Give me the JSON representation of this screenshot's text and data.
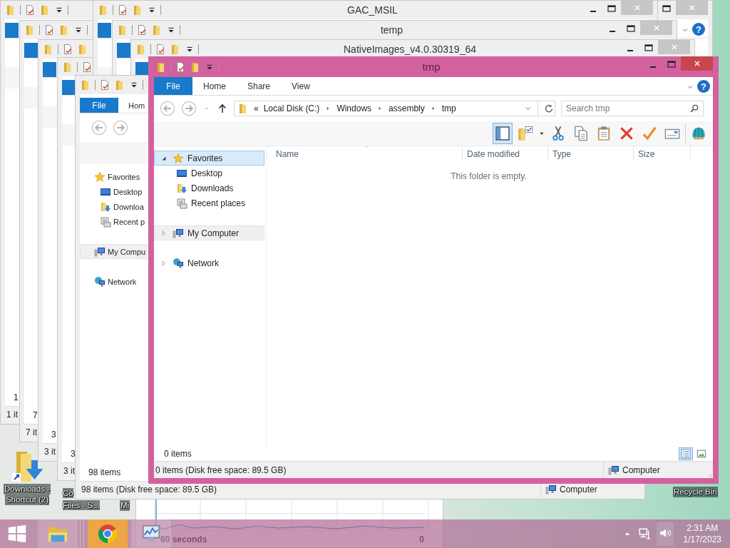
{
  "desktop_icons": [
    {
      "lines": [
        "Downloads -",
        "Shortcut (2)"
      ]
    },
    {
      "lines": [
        "Co",
        "Files - S..."
      ]
    },
    {
      "lines": [
        "Mi"
      ]
    }
  ],
  "recycle_bin": "Recycle Bin",
  "chart_window": {
    "x_label": "60 seconds",
    "y_value": "0"
  },
  "background_windows": [
    {
      "count": "1",
      "status": "1 it",
      "help": "?"
    },
    {
      "count": "7",
      "status": "7 it"
    },
    {
      "count": "3",
      "status": "3 it"
    },
    {
      "count": "3",
      "status": "3 it"
    },
    {
      "title": "GAC_MSIL"
    },
    {
      "title": "temp"
    },
    {
      "title": "NativeImages_v4.0.30319_64"
    },
    {
      "tabs": [
        {
          "label": "File",
          "kind": "file"
        },
        {
          "label": "Hom",
          "kind": "tab"
        }
      ],
      "nav": [
        {
          "label": "Favorites",
          "selected": false,
          "shaded": false,
          "children": [
            {
              "label": "Desktop"
            },
            {
              "label": "Downloa"
            },
            {
              "label": "Recent p"
            }
          ]
        },
        {
          "label": "My Compu",
          "selected": false,
          "shaded": true
        },
        {
          "label": "Network",
          "selected": false,
          "shaded": false
        }
      ],
      "count": "98 items",
      "status": "98 items (Disk free space: 89.5 GB)",
      "location": "Computer"
    }
  ],
  "window": {
    "title": "tmp",
    "tabs": [
      {
        "label": "File",
        "kind": "file"
      },
      {
        "label": "Home",
        "kind": "tab"
      },
      {
        "label": "Share",
        "kind": "tab"
      },
      {
        "label": "View",
        "kind": "tab"
      }
    ],
    "help": "?",
    "address": {
      "overflow": "«",
      "crumbs": [
        "Local Disk (C:)",
        "Windows",
        "assembly",
        "tmp"
      ]
    },
    "search": {
      "placeholder": "Search tmp"
    },
    "toolbar": [
      {
        "selected": true
      },
      {
        "selected": false
      },
      {
        "selected": false
      },
      {
        "selected": false
      },
      {
        "selected": false
      },
      {
        "selected": false
      },
      {
        "selected": false
      },
      {
        "selected": false
      },
      {
        "selected": false
      }
    ],
    "nav": [
      {
        "label": "Favorites",
        "expanded": true,
        "selected": true,
        "shaded": false,
        "children": [
          {
            "label": "Desktop"
          },
          {
            "label": "Downloads"
          },
          {
            "label": "Recent places"
          }
        ]
      },
      {
        "label": "My Computer",
        "expanded": false,
        "selected": false,
        "shaded": true
      },
      {
        "label": "Network",
        "expanded": false,
        "selected": false,
        "shaded": false
      }
    ],
    "columns": [
      {
        "label": "Name",
        "sorted": true
      },
      {
        "label": "Date modified",
        "sorted": false
      },
      {
        "label": "Type",
        "sorted": false
      },
      {
        "label": "Size",
        "sorted": false
      }
    ],
    "empty_message": "This folder is empty.",
    "item_count": "0 items",
    "views": [
      {
        "selected": true
      },
      {
        "selected": false
      }
    ],
    "status": "0 items (Disk free space: 89.5 GB)",
    "location": "Computer"
  },
  "taskbar": {
    "apps": [
      {
        "selected": false
      },
      {
        "selected": true
      },
      {
        "selected": false
      }
    ],
    "time": "2:31 AM",
    "date": "1/17/2023"
  }
}
